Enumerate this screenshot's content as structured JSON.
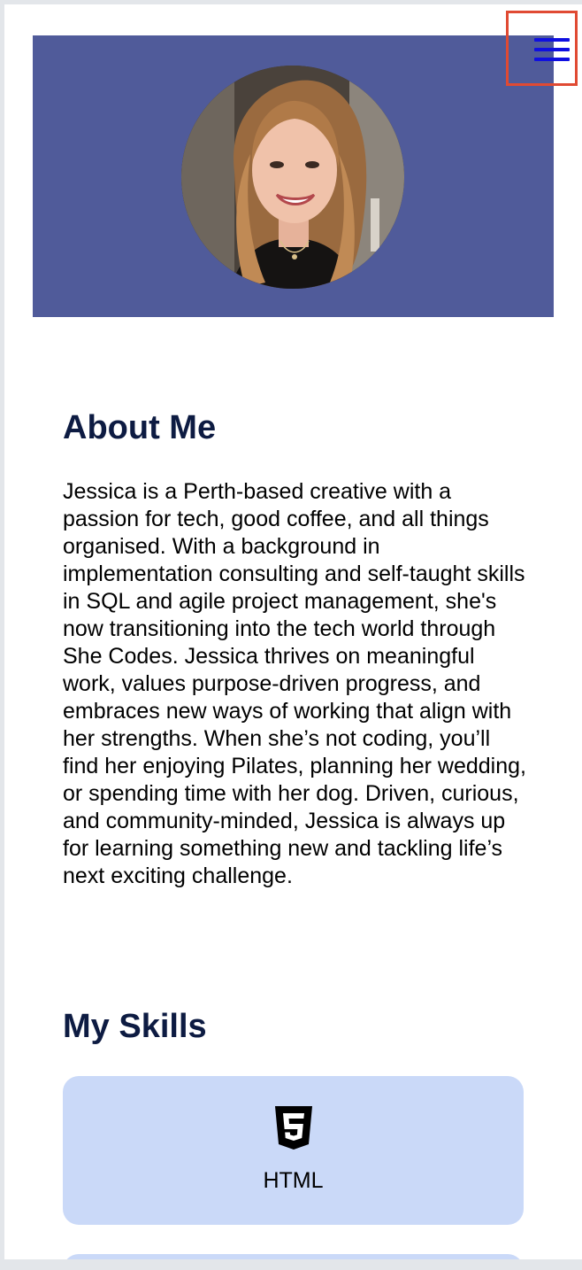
{
  "header": {
    "menu_icon": "hamburger-menu-icon",
    "profile_photo_alt": "Jessica",
    "hero_color": "#505b9a",
    "menu_color": "#1010e0",
    "highlight_color": "#e04a33"
  },
  "about": {
    "title": "About Me",
    "text": "Jessica is a Perth-based creative with a passion for tech, good coffee, and all things organised. With a background in implementation consulting and self-taught skills in SQL and agile project management, she's now transitioning into the tech world through She Codes. Jessica thrives on meaningful work, values purpose-driven progress, and embraces new ways of working that align with her strengths. When she’s not coding, you’ll find her enjoying Pilates, planning her wedding, or spending time with her dog. Driven, curious, and community-minded, Jessica is always up for learning something new and tackling life’s next exciting challenge."
  },
  "skills": {
    "title": "My Skills",
    "card_color": "#cad9f8",
    "items": [
      {
        "icon": "html5-icon",
        "label": "HTML"
      }
    ]
  }
}
